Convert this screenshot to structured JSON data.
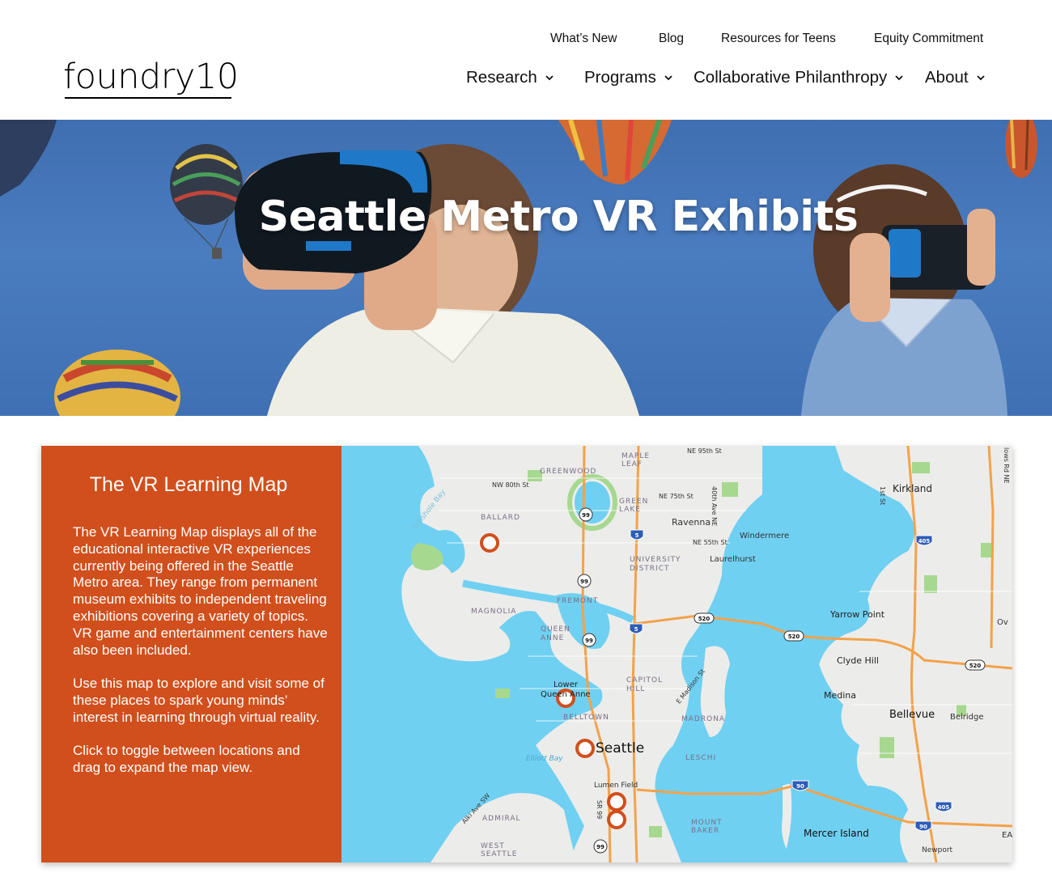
{
  "logo": {
    "text": "foundry10"
  },
  "util_nav": [
    {
      "label": "What’s New"
    },
    {
      "label": "Blog"
    },
    {
      "label": "Resources for Teens"
    },
    {
      "label": "Equity Commitment"
    }
  ],
  "main_nav": [
    {
      "label": "Research"
    },
    {
      "label": "Programs"
    },
    {
      "label": "Collaborative Philanthropy"
    },
    {
      "label": "About"
    }
  ],
  "hero": {
    "title": "Seattle Metro VR Exhibits"
  },
  "panel": {
    "title": "The VR Learning Map",
    "paragraphs": [
      "The VR Learning Map displays all of the educational interactive VR experiences currently being offered in the Seattle Metro area. They range from permanent museum exhibits to independent traveling exhibitions covering a variety of topics. VR game and entertainment centers have also been included.",
      "Use this map to explore and visit some of these places to spark young minds’ interest in learning through virtual reality.",
      "Click to toggle between locations and drag to expand the map view."
    ]
  },
  "map": {
    "colors": {
      "water": "#6fd0f2",
      "land": "#ececea",
      "park": "#a7d88f",
      "highway": "#f3a24a",
      "marker": "#d14f1c"
    },
    "labels": {
      "greenwood": "GREENWOOD",
      "maple_leaf": "MAPLE\nLEAF",
      "ne95": "NE 95th St",
      "nw80": "NW 80th St",
      "ballard": "BALLARD",
      "green_lake": "GREEN\nLAKE",
      "ne75": "NE 75th St",
      "ave40": "40th Ave NE",
      "ravenna": "Ravenna",
      "kirkland": "Kirkland",
      "ave1": "1st St",
      "ne55": "NE 55th St",
      "windermere": "Windermere",
      "university": "UNIVERSITY\nDISTRICT",
      "laurelhurst": "Laurelhurst",
      "shilshole": "Shilshole Bay",
      "magnolia": "MAGNOLIA",
      "fremont": "FREMONT",
      "queen_anne": "QUEEN\nANNE",
      "yarrow": "Yarrow Point",
      "clyde": "Clyde Hill",
      "medina": "Medina",
      "capitol": "CAPITOL\nHILL",
      "madison": "E Madison St",
      "lower": "Lower",
      "queen_anne_low": "Queen Anne",
      "belltown": "BELLTOWN",
      "madrona": "MADRONA",
      "bellevue": "Bellevue",
      "belridge": "Belridge",
      "seattle": "Seattle",
      "elliott": "Elliott Bay",
      "leschi": "LESCHI",
      "lumen": "Lumen Field",
      "alki": "Alki Ave SW",
      "sr99": "SR 99",
      "admiral": "ADMIRAL",
      "mount_baker": "MOUNT\nBAKER",
      "mercer": "Mercer Island",
      "west_seattle": "WEST\nSEATTLE",
      "newport": "Newport",
      "ov": "Ov",
      "ea": "EA",
      "lows": "lows Rd NE"
    },
    "shields": [
      "99",
      "5",
      "99",
      "99",
      "520",
      "520",
      "520",
      "5",
      "405",
      "90",
      "405",
      "90",
      "99"
    ]
  }
}
